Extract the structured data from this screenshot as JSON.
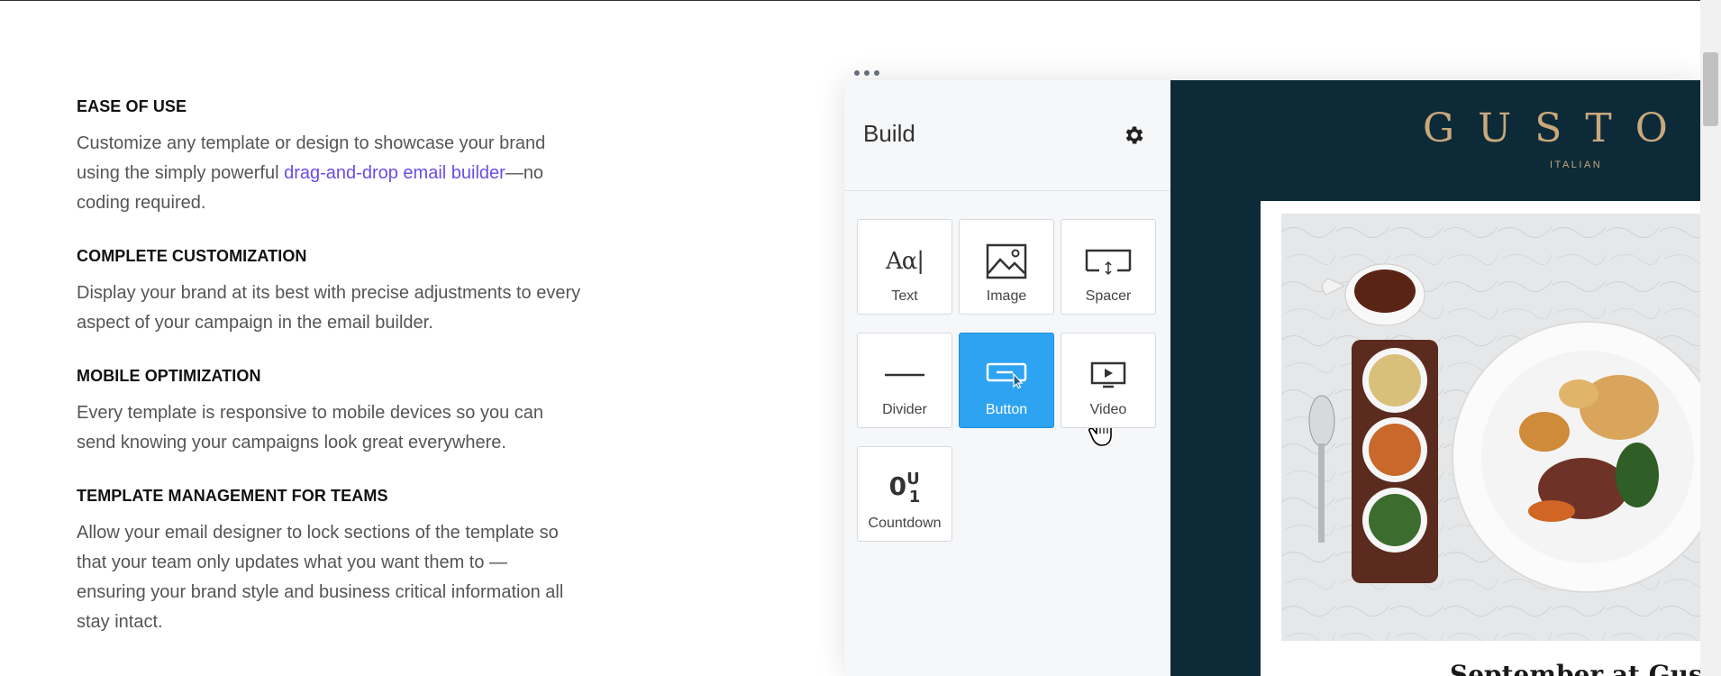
{
  "features": [
    {
      "heading": "EASE OF USE",
      "text_before": "Customize any template or design to showcase your brand using the simply powerful ",
      "link": "drag-and-drop email builder",
      "text_after": "—no coding required."
    },
    {
      "heading": "COMPLETE CUSTOMIZATION",
      "text": "Display your brand at its best with precise adjustments to every aspect of your campaign in the email builder."
    },
    {
      "heading": "MOBILE OPTIMIZATION",
      "text": "Every template is responsive to mobile devices so you can send knowing your campaigns look great everywhere."
    },
    {
      "heading": "TEMPLATE MANAGEMENT FOR TEAMS",
      "text": "Allow your email designer to lock sections of the template so that your team only updates what you want them to — ensuring your brand style and business critical information all stay intact."
    }
  ],
  "builder": {
    "title": "Build",
    "tiles": [
      {
        "label": "Text",
        "icon": "text-icon"
      },
      {
        "label": "Image",
        "icon": "image-icon"
      },
      {
        "label": "Spacer",
        "icon": "spacer-icon"
      },
      {
        "label": "Divider",
        "icon": "divider-icon"
      },
      {
        "label": "Button",
        "icon": "button-icon",
        "active": true
      },
      {
        "label": "Video",
        "icon": "video-icon"
      },
      {
        "label": "Countdown",
        "icon": "countdown-icon"
      }
    ],
    "text_icon_glyph": "Aα|",
    "countdown_glyph_main": "0",
    "countdown_glyph_top": "U",
    "countdown_glyph_bottom": "1"
  },
  "preview": {
    "brand": "GUSTO",
    "brand_sub": "ITALIAN",
    "heading": "September at Gusto"
  },
  "colors": {
    "accent": "#2ea3f2",
    "link": "#6a4ce8",
    "preview_bg": "#0d2a38",
    "brand_gold": "#c8a87c"
  }
}
